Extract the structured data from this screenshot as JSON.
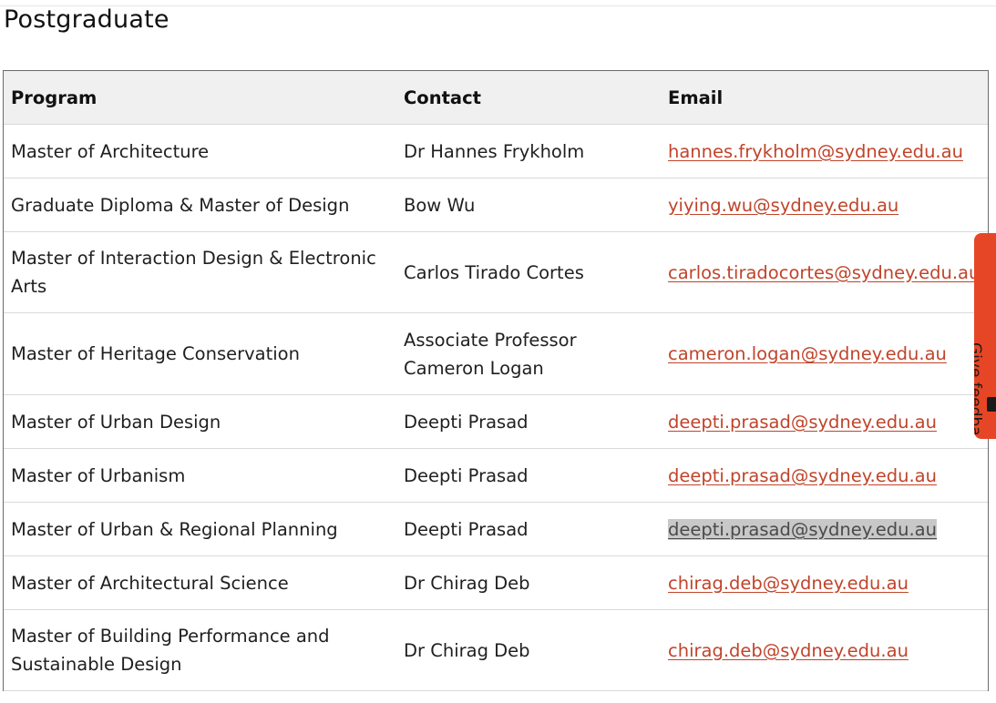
{
  "page": {
    "title": "Postgraduate"
  },
  "table": {
    "headers": {
      "program": "Program",
      "contact": "Contact",
      "email": "Email"
    },
    "rows": [
      {
        "program": "Master of Architecture",
        "contact": "Dr Hannes Frykholm",
        "email": "hannes.frykholm@sydney.edu.au"
      },
      {
        "program": "Graduate Diploma & Master of Design",
        "contact": "Bow Wu",
        "email": "yiying.wu@sydney.edu.au"
      },
      {
        "program": "Master of Interaction Design & Electronic Arts",
        "contact": "Carlos Tirado Cortes",
        "email": "carlos.tiradocortes@sydney.edu.au"
      },
      {
        "program": "Master of Heritage Conservation",
        "contact": "Associate Professor Cameron Logan",
        "email": "cameron.logan@sydney.edu.au"
      },
      {
        "program": "Master of Urban Design",
        "contact": "Deepti Prasad",
        "email": "deepti.prasad@sydney.edu.au"
      },
      {
        "program": "Master of Urbanism",
        "contact": "Deepti Prasad",
        "email": "deepti.prasad@sydney.edu.au"
      },
      {
        "program": "Master of Urban & Regional Planning",
        "contact": "Deepti Prasad",
        "email": "deepti.prasad@sydney.edu.au",
        "selected": true
      },
      {
        "program": "Master of Architectural Science",
        "contact": "Dr Chirag Deb",
        "email": "chirag.deb@sydney.edu.au"
      },
      {
        "program": "Master of Building Performance and Sustainable Design",
        "contact": "Dr Chirag Deb",
        "email": "chirag.deb@sydney.edu.au"
      }
    ]
  },
  "feedback": {
    "label": "Give feedback",
    "icon": "megaphone-icon",
    "color": "#e64626"
  },
  "colors": {
    "link": "#c0442a",
    "header_bg": "#f0f0f0",
    "selection": "#c8c8c8"
  }
}
